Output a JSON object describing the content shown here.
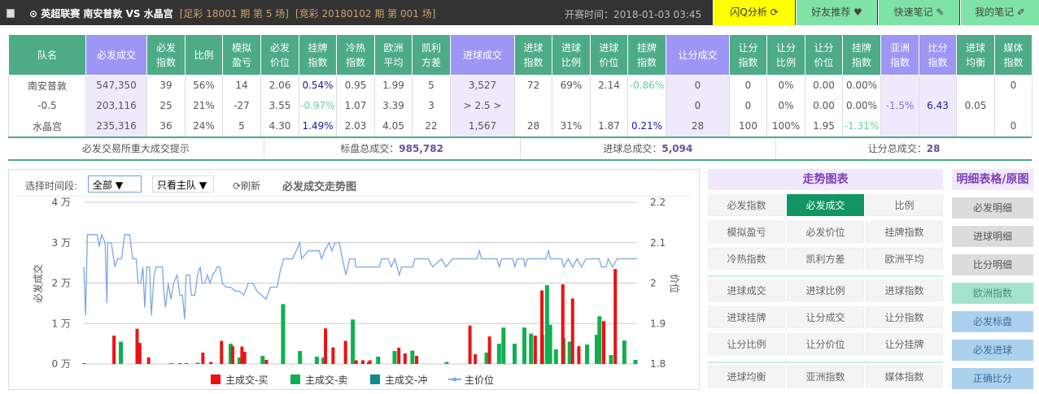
{
  "topbar": {
    "title": "⊙ 英超联赛  南安普敦  VS 水晶宫",
    "zucai": "[足彩 18001 期 第 5 场]",
    "jingcai": "[竞彩 20180102 期 第 001 场]",
    "start_time": "开赛时间：2018-01-03 03:45",
    "buttons": [
      {
        "label": "闪Q分析 ⟳",
        "icon": "flash-q-icon"
      },
      {
        "label": "好友推荐 ♥",
        "icon": "heart-icon"
      },
      {
        "label": "快速笔记 ✎",
        "icon": "edit-icon"
      },
      {
        "label": "我的笔记 ✐",
        "icon": "pencil-icon"
      }
    ]
  },
  "table": {
    "headers": [
      [
        "队名",
        ""
      ],
      [
        "必发成交",
        "p"
      ],
      [
        "必发\n指数",
        ""
      ],
      [
        "比例",
        ""
      ],
      [
        "模拟\n盈亏",
        ""
      ],
      [
        "必发\n价位",
        ""
      ],
      [
        "挂牌\n指数",
        ""
      ],
      [
        "冷热\n指数",
        ""
      ],
      [
        "欧洲\n平均",
        ""
      ],
      [
        "凯利\n方差",
        ""
      ],
      [
        "进球成交",
        "p"
      ],
      [
        "进球\n指数",
        ""
      ],
      [
        "进球\n比例",
        ""
      ],
      [
        "进球\n价位",
        ""
      ],
      [
        "挂牌\n指数",
        ""
      ],
      [
        "让分成交",
        "p"
      ],
      [
        "让分\n指数",
        ""
      ],
      [
        "让分\n比例",
        ""
      ],
      [
        "让分\n价位",
        ""
      ],
      [
        "挂牌\n指数",
        ""
      ],
      [
        "亚洲\n指数",
        "p"
      ],
      [
        "比分\n指数",
        "p"
      ],
      [
        "进球\n均衡",
        ""
      ],
      [
        "媒体\n指数",
        ""
      ]
    ],
    "rows": [
      [
        {
          "v": "南安普敦"
        },
        {
          "v": "547,350"
        },
        {
          "v": "39"
        },
        {
          "v": "56%"
        },
        {
          "v": "14"
        },
        {
          "v": "2.06"
        },
        {
          "v": "0.54%",
          "c": "blue"
        },
        {
          "v": "0.95"
        },
        {
          "v": "1.99"
        },
        {
          "v": "5"
        },
        {
          "v": "3,527"
        },
        {
          "v": "72"
        },
        {
          "v": "69%"
        },
        {
          "v": "2.14"
        },
        {
          "v": "-0.86%",
          "c": "green"
        },
        {
          "v": "0"
        },
        {
          "v": "0"
        },
        {
          "v": "0%"
        },
        {
          "v": "0.00"
        },
        {
          "v": "0.00%"
        },
        {
          "v": ""
        },
        {
          "v": ""
        },
        {
          "v": ""
        },
        {
          "v": "0"
        }
      ],
      [
        {
          "v": "-0.5"
        },
        {
          "v": "203,116"
        },
        {
          "v": "25"
        },
        {
          "v": "21%"
        },
        {
          "v": "-27"
        },
        {
          "v": "3.55"
        },
        {
          "v": "-0.97%",
          "c": "green"
        },
        {
          "v": "1.07"
        },
        {
          "v": "3.39"
        },
        {
          "v": "3"
        },
        {
          "v": "> 2.5 >"
        },
        {
          "v": ""
        },
        {
          "v": ""
        },
        {
          "v": ""
        },
        {
          "v": ""
        },
        {
          "v": "0"
        },
        {
          "v": "0"
        },
        {
          "v": "0%"
        },
        {
          "v": "0.00"
        },
        {
          "v": "0.00%"
        },
        {
          "v": "-1.5%",
          "c": "purple"
        },
        {
          "v": "6.43",
          "c": "blue"
        },
        {
          "v": "0.05"
        },
        {
          "v": ""
        }
      ],
      [
        {
          "v": "水晶宫"
        },
        {
          "v": "235,316"
        },
        {
          "v": "36"
        },
        {
          "v": "24%"
        },
        {
          "v": "5"
        },
        {
          "v": "4.30"
        },
        {
          "v": "1.49%",
          "c": "blue"
        },
        {
          "v": "2.03"
        },
        {
          "v": "4.05"
        },
        {
          "v": "22"
        },
        {
          "v": "1,567"
        },
        {
          "v": "28"
        },
        {
          "v": "31%"
        },
        {
          "v": "1.87"
        },
        {
          "v": "0.21%",
          "c": "blue"
        },
        {
          "v": "28"
        },
        {
          "v": "100"
        },
        {
          "v": "100%"
        },
        {
          "v": "1.95"
        },
        {
          "v": "-1.31%",
          "c": "green"
        },
        {
          "v": ""
        },
        {
          "v": ""
        },
        {
          "v": ""
        },
        {
          "v": "0"
        }
      ]
    ]
  },
  "summary": {
    "hint": "必发交易所重大成交提示",
    "biaopan_label": "标盘总成交：",
    "biaopan": "985,782",
    "jinqiu_label": "进球总成交：",
    "jinqiu": "5,094",
    "rangfen_label": "让分总成交：",
    "rangfen": "28"
  },
  "controls": {
    "period_label": "选择时间段:",
    "period_value": "全部 ▼",
    "team_value": "只看主队 ▼",
    "refresh": "⟳刷新",
    "chart_title": "必发成交走势图"
  },
  "chart_data": {
    "type": "bar+line",
    "title": "必发成交走势图",
    "ylabel": "必发成交",
    "y2label": "价位",
    "ylim": [
      0,
      4
    ],
    "y_ticks": [
      "0 万",
      "1 万",
      "2 万",
      "3 万",
      "4 万"
    ],
    "y2lim": [
      1.8,
      2.2
    ],
    "y2_ticks": [
      "1.8",
      "1.9",
      "2",
      "2.1",
      "2.2"
    ],
    "xlim": [
      0,
      1245
    ],
    "legend": [
      "主成交-买",
      "主成交-卖",
      "主成交-冲",
      "主价位"
    ],
    "colors": {
      "buy": "#ee1111",
      "sell": "#10b050",
      "hedge": "#128a8a",
      "price": "#7aa9e0"
    },
    "bars": [
      [
        0,
        0.02,
        0
      ],
      [
        67,
        0.7,
        0
      ],
      [
        77,
        0,
        0.55
      ],
      [
        119,
        0.87,
        0
      ],
      [
        125,
        0.52,
        0
      ],
      [
        145,
        0.16,
        0
      ],
      [
        190,
        0,
        0.02
      ],
      [
        215,
        0.02,
        0
      ],
      [
        230,
        0.02,
        0
      ],
      [
        250,
        0,
        0.03
      ],
      [
        267,
        0.28,
        0
      ],
      [
        285,
        0.05,
        0
      ],
      [
        309,
        0.57,
        0
      ],
      [
        324,
        0,
        0.5
      ],
      [
        334,
        0.44,
        0
      ],
      [
        344,
        0,
        0.16
      ],
      [
        355,
        0.43,
        0
      ],
      [
        361,
        0.3,
        0
      ],
      [
        396,
        0,
        0.2
      ],
      [
        410,
        0.1,
        0
      ],
      [
        442,
        0,
        1.48
      ],
      [
        480,
        0,
        0.32
      ],
      [
        518,
        0,
        0.18
      ],
      [
        533,
        0,
        0.16
      ],
      [
        543,
        0.88,
        0
      ],
      [
        560,
        0.41,
        0
      ],
      [
        588,
        0.57,
        0
      ],
      [
        599,
        0,
        1.1
      ],
      [
        612,
        0.09,
        0
      ],
      [
        627,
        0.09,
        0
      ],
      [
        640,
        0.05,
        0
      ],
      [
        643,
        0.09,
        0
      ],
      [
        656,
        0,
        0.18
      ],
      [
        693,
        0,
        0.32
      ],
      [
        708,
        0.4,
        0
      ],
      [
        722,
        0.26,
        0
      ],
      [
        733,
        0,
        0.33
      ],
      [
        748,
        0.2,
        0
      ],
      [
        810,
        0,
        0.05
      ],
      [
        868,
        0.95,
        0
      ],
      [
        880,
        0.24,
        0
      ],
      [
        900,
        0,
        0.28
      ],
      [
        912,
        0.68,
        0
      ],
      [
        928,
        0,
        0.5
      ],
      [
        938,
        0,
        0.9
      ],
      [
        963,
        0,
        0.5
      ],
      [
        985,
        0,
        0.9
      ],
      [
        1000,
        0,
        0.75
      ],
      [
        1015,
        0.7,
        0
      ],
      [
        1025,
        0,
        0.72
      ],
      [
        1030,
        1.82,
        0
      ],
      [
        1036,
        0,
        1.95
      ],
      [
        1043,
        0,
        0.97
      ],
      [
        1056,
        0,
        0.36
      ],
      [
        1073,
        0,
        0.64
      ],
      [
        1077,
        1.97,
        0
      ],
      [
        1087,
        0,
        0.55
      ],
      [
        1099,
        1.62,
        0
      ],
      [
        1113,
        0.44,
        0
      ],
      [
        1126,
        0,
        0.48
      ],
      [
        1148,
        0,
        0.72
      ],
      [
        1154,
        0,
        1.18
      ],
      [
        1169,
        1.06,
        0
      ],
      [
        1180,
        0,
        0.22
      ],
      [
        1195,
        2.35,
        0
      ],
      [
        1210,
        0,
        0.58
      ],
      [
        1235,
        0,
        0.1
      ]
    ],
    "price": [
      [
        0,
        2.04
      ],
      [
        4,
        1.92
      ],
      [
        8,
        2.12
      ],
      [
        30,
        2.12
      ],
      [
        35,
        2.09
      ],
      [
        40,
        2.12
      ],
      [
        48,
        2.1
      ],
      [
        52,
        1.95
      ],
      [
        54,
        2.1
      ],
      [
        62,
        2.1
      ],
      [
        70,
        2.04
      ],
      [
        76,
        2.06
      ],
      [
        85,
        2.06
      ],
      [
        92,
        2.12
      ],
      [
        103,
        2.12
      ],
      [
        110,
        2.06
      ],
      [
        118,
        2.06
      ],
      [
        122,
        2.0
      ],
      [
        128,
        2.0
      ],
      [
        133,
        2.04
      ],
      [
        137,
        1.94
      ],
      [
        142,
        2.04
      ],
      [
        148,
        2.04
      ],
      [
        152,
        1.92
      ],
      [
        158,
        2.02
      ],
      [
        163,
        2.04
      ],
      [
        177,
        2.04
      ],
      [
        180,
        1.98
      ],
      [
        184,
        1.94
      ],
      [
        190,
        2.0
      ],
      [
        196,
        1.96
      ],
      [
        202,
        2.0
      ],
      [
        210,
        2.02
      ],
      [
        216,
        1.97
      ],
      [
        222,
        1.97
      ],
      [
        227,
        1.91
      ],
      [
        230,
        2.02
      ],
      [
        238,
        2.02
      ],
      [
        242,
        1.97
      ],
      [
        250,
        1.97
      ],
      [
        256,
        2.02
      ],
      [
        262,
        2.04
      ],
      [
        266,
        2.0
      ],
      [
        272,
        2.0
      ],
      [
        278,
        2.02
      ],
      [
        284,
        2.0
      ],
      [
        290,
        2.02
      ],
      [
        296,
        2.03
      ],
      [
        300,
        2.04
      ],
      [
        306,
        2.04
      ],
      [
        312,
        2.0
      ],
      [
        320,
        1.99
      ],
      [
        330,
        1.99
      ],
      [
        342,
        1.98
      ],
      [
        350,
        1.98
      ],
      [
        360,
        1.97
      ],
      [
        370,
        2.0
      ],
      [
        380,
        2.0
      ],
      [
        390,
        1.98
      ],
      [
        400,
        1.97
      ],
      [
        410,
        1.96
      ],
      [
        420,
        1.99
      ],
      [
        435,
        1.99
      ],
      [
        442,
        2.03
      ],
      [
        450,
        2.06
      ],
      [
        470,
        2.06
      ],
      [
        478,
        2.08
      ],
      [
        486,
        2.1
      ],
      [
        490,
        2.06
      ],
      [
        505,
        2.08
      ],
      [
        530,
        2.08
      ],
      [
        535,
        2.06
      ],
      [
        542,
        2.08
      ],
      [
        552,
        2.1
      ],
      [
        558,
        2.08
      ],
      [
        565,
        2.1
      ],
      [
        575,
        2.1
      ],
      [
        582,
        2.06
      ],
      [
        590,
        2.02
      ],
      [
        598,
        2.06
      ],
      [
        610,
        2.06
      ],
      [
        612,
        2.04
      ],
      [
        665,
        2.04
      ],
      [
        670,
        2.06
      ],
      [
        685,
        2.06
      ],
      [
        692,
        2.04
      ],
      [
        700,
        2.06
      ],
      [
        710,
        2.02
      ],
      [
        715,
        2.04
      ],
      [
        740,
        2.04
      ],
      [
        745,
        2.06
      ],
      [
        775,
        2.06
      ],
      [
        785,
        2.04
      ],
      [
        805,
        2.06
      ],
      [
        815,
        2.04
      ],
      [
        830,
        2.06
      ],
      [
        885,
        2.06
      ],
      [
        890,
        2.08
      ],
      [
        895,
        2.06
      ],
      [
        930,
        2.06
      ],
      [
        935,
        2.04
      ],
      [
        940,
        2.06
      ],
      [
        965,
        2.06
      ],
      [
        970,
        2.04
      ],
      [
        975,
        2.06
      ],
      [
        990,
        2.06
      ],
      [
        993,
        2.04
      ],
      [
        998,
        2.06
      ],
      [
        1040,
        2.06
      ],
      [
        1046,
        2.08
      ],
      [
        1050,
        2.06
      ],
      [
        1075,
        2.06
      ],
      [
        1080,
        2.04
      ],
      [
        1090,
        2.06
      ],
      [
        1100,
        2.04
      ],
      [
        1110,
        2.06
      ],
      [
        1120,
        2.04
      ],
      [
        1130,
        2.06
      ],
      [
        1160,
        2.06
      ],
      [
        1165,
        2.04
      ],
      [
        1175,
        2.04
      ],
      [
        1180,
        2.06
      ],
      [
        1190,
        2.04
      ],
      [
        1200,
        2.06
      ],
      [
        1245,
        2.06
      ]
    ]
  },
  "trend_panel": {
    "title": "走势图表",
    "groups": [
      [
        "必发指数",
        "必发成交",
        "比例",
        "模拟盈亏",
        "必发价位",
        "挂牌指数",
        "冷热指数",
        "凯利方差",
        "欧洲平均"
      ],
      [
        "进球成交",
        "进球比例",
        "进球指数",
        "进球挂牌",
        "让分成交",
        "让分指数",
        "让分比例",
        "让分价位",
        "让分挂牌"
      ],
      [
        "进球均衡",
        "亚洲指数",
        "媒体指数"
      ]
    ],
    "active": "必发成交"
  },
  "detail_panel": {
    "title": "明细表格/原图",
    "items": [
      [
        "必发明细",
        ""
      ],
      [
        "进球明细",
        ""
      ],
      [
        "比分明细",
        ""
      ],
      [
        "欧洲指数",
        "g"
      ],
      [
        "必发标盘",
        "b"
      ],
      [
        "必发进球",
        "b"
      ],
      [
        "正确比分",
        "b"
      ]
    ]
  }
}
